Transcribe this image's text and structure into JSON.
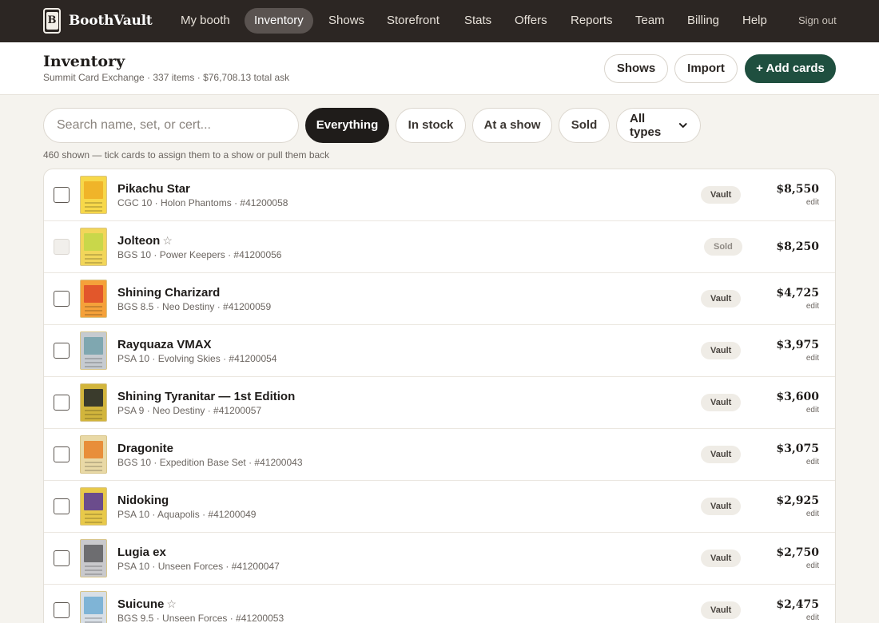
{
  "app": {
    "name": "BoothVault",
    "logo_letter": "B"
  },
  "nav": {
    "items": [
      {
        "label": "My booth"
      },
      {
        "label": "Inventory",
        "active": true
      },
      {
        "label": "Shows"
      },
      {
        "label": "Storefront"
      },
      {
        "label": "Stats"
      },
      {
        "label": "Offers"
      },
      {
        "label": "Reports"
      },
      {
        "label": "Team"
      },
      {
        "label": "Billing"
      },
      {
        "label": "Help"
      }
    ],
    "signout": "Sign out"
  },
  "header": {
    "title": "Inventory",
    "subtitle": "Summit Card Exchange · 337 items · $76,708.13 total ask",
    "shows_btn": "Shows",
    "import_btn": "Import",
    "add_btn": "+ Add cards"
  },
  "filters": {
    "search_placeholder": "Search name, set, or cert...",
    "pills": [
      {
        "label": "Everything",
        "active": true
      },
      {
        "label": "In stock"
      },
      {
        "label": "At a show"
      },
      {
        "label": "Sold"
      }
    ],
    "type_select": "All types",
    "hint": "460 shown — tick cards to assign them to a show or pull them back"
  },
  "cards": [
    {
      "name": "Pikachu Star",
      "star": false,
      "meta": "CGC 10 · Holon Phantoms · #41200058",
      "badge": "Vault",
      "sold": false,
      "price": "$8,550",
      "edit": "edit",
      "art": "#f0b429",
      "frame": "#f7d84a"
    },
    {
      "name": "Jolteon",
      "star": true,
      "meta": "BGS 10 · Power Keepers · #41200056",
      "badge": "Sold",
      "sold": true,
      "price": "$8,250",
      "edit": "",
      "art": "#c9d74a",
      "frame": "#f2d65a"
    },
    {
      "name": "Shining Charizard",
      "star": false,
      "meta": "BGS 8.5 · Neo Destiny · #41200059",
      "badge": "Vault",
      "sold": false,
      "price": "$4,725",
      "edit": "edit",
      "art": "#e2572b",
      "frame": "#f5a13a"
    },
    {
      "name": "Rayquaza VMAX",
      "star": false,
      "meta": "PSA 10 · Evolving Skies · #41200054",
      "badge": "Vault",
      "sold": false,
      "price": "$3,975",
      "edit": "edit",
      "art": "#7fa7b0",
      "frame": "#c6cbd0"
    },
    {
      "name": "Shining Tyranitar — 1st Edition",
      "star": false,
      "meta": "PSA 9 · Neo Destiny · #41200057",
      "badge": "Vault",
      "sold": false,
      "price": "$3,600",
      "edit": "edit",
      "art": "#3a3b2c",
      "frame": "#d2b53c"
    },
    {
      "name": "Dragonite",
      "star": false,
      "meta": "BGS 10 · Expedition Base Set · #41200043",
      "badge": "Vault",
      "sold": false,
      "price": "$3,075",
      "edit": "edit",
      "art": "#e88e3a",
      "frame": "#e9d9a6"
    },
    {
      "name": "Nidoking",
      "star": false,
      "meta": "PSA 10 · Aquapolis · #41200049",
      "badge": "Vault",
      "sold": false,
      "price": "$2,925",
      "edit": "edit",
      "art": "#6b4c8c",
      "frame": "#e8c94a"
    },
    {
      "name": "Lugia ex",
      "star": false,
      "meta": "PSA 10 · Unseen Forces · #41200047",
      "badge": "Vault",
      "sold": false,
      "price": "$2,750",
      "edit": "edit",
      "art": "#6d6d70",
      "frame": "#c9c9cc"
    },
    {
      "name": "Suicune",
      "star": true,
      "meta": "BGS 9.5 · Unseen Forces · #41200053",
      "badge": "Vault",
      "sold": false,
      "price": "$2,475",
      "edit": "edit",
      "art": "#7fb4d6",
      "frame": "#d8dfe6"
    }
  ]
}
